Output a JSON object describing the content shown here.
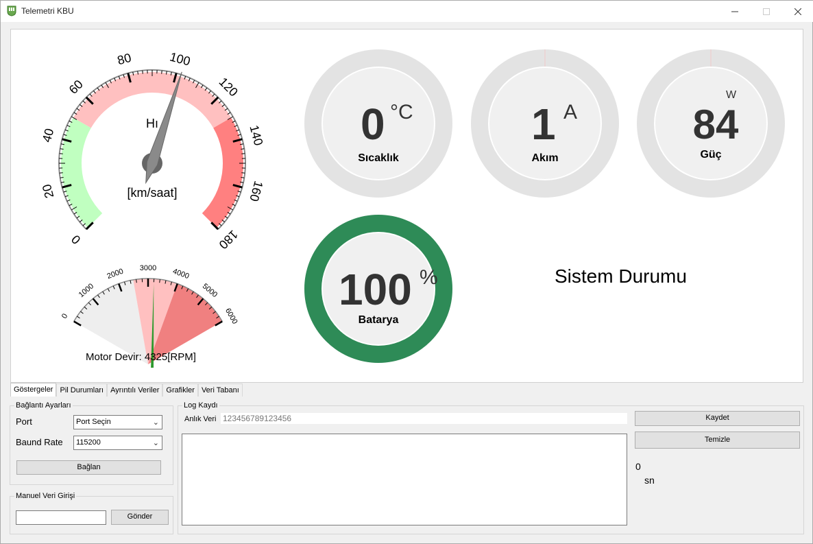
{
  "window": {
    "title": "Telemetri KBU",
    "minimize_icon": "minimize-icon",
    "maximize_icon": "maximize-icon",
    "close_icon": "close-icon"
  },
  "speedometer": {
    "label": "Hı",
    "unit": "[km/saat]",
    "ticks": [
      "0",
      "20",
      "40",
      "60",
      "80",
      "100",
      "120",
      "140",
      "160",
      "180"
    ],
    "min": 0,
    "max": 180,
    "value": 102,
    "zones": [
      {
        "from": 0,
        "to": 50,
        "color": "#c0ffc0"
      },
      {
        "from": 50,
        "to": 130,
        "color": "#ffc0c0"
      },
      {
        "from": 130,
        "to": 180,
        "color": "#ff8080"
      }
    ]
  },
  "rpm": {
    "caption": "Motor Devir:",
    "value_text": "4325[RPM]",
    "ticks": [
      "0",
      "1000",
      "2000",
      "3000",
      "4000",
      "5000",
      "6000"
    ],
    "min": 0,
    "max": 6000,
    "needle_value": 3200
  },
  "gauges": {
    "temperature": {
      "value": "0",
      "unit": "°C",
      "label": "Sıcaklık"
    },
    "current": {
      "value": "1",
      "unit": "A",
      "label": "Akım"
    },
    "power": {
      "value": "84",
      "unit": "W",
      "label": "Güç"
    },
    "battery": {
      "value": "100",
      "unit": "%",
      "label": "Batarya",
      "level": 1.0,
      "color": "#2e8b57"
    }
  },
  "status": {
    "title": "Sistem Durumu"
  },
  "tabs": [
    "Göstergeler",
    "Pil Durumları",
    "Ayrıntılı Veriler",
    "Grafikler",
    "Veri Tabanı"
  ],
  "connection": {
    "group_title": "Bağlantı Ayarları",
    "port_label": "Port",
    "port_value": "Port Seçin",
    "baud_label": "Baund Rate",
    "baud_value": "115200",
    "connect_button": "Bağlan"
  },
  "manual": {
    "group_title": "Manuel Veri Girişi",
    "input_value": "",
    "send_button": "Gönder"
  },
  "log": {
    "group_title": "Log Kaydı",
    "instant_label": "Anlık Veri",
    "instant_value": "123456789123456",
    "log_text": ""
  },
  "actions": {
    "save_button": "Kaydet",
    "clear_button": "Temizle",
    "timer_value": "0",
    "timer_unit": "sn"
  }
}
